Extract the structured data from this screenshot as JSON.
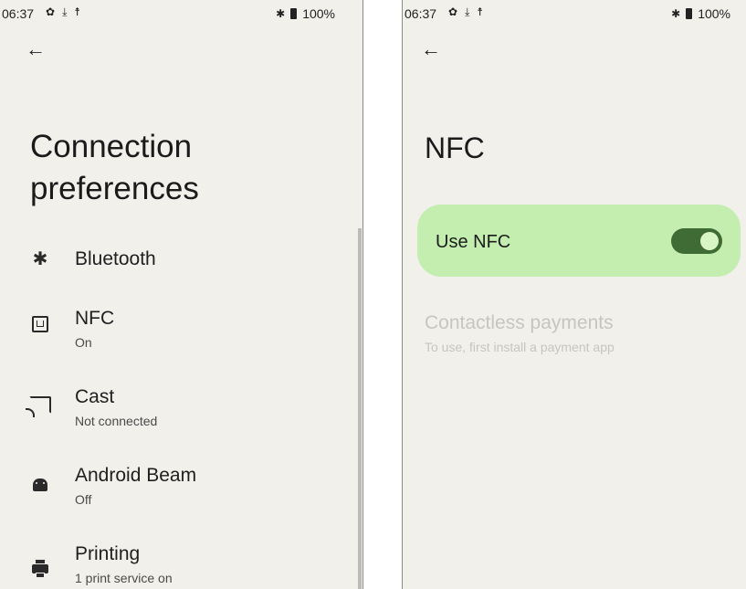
{
  "status_bar": {
    "time": "06:37",
    "battery": "100%",
    "icons": [
      "settings-icon",
      "download-icon",
      "accessibility-icon",
      "bluetooth-icon",
      "battery-icon"
    ]
  },
  "left_screen": {
    "title": "Connection preferences",
    "items": [
      {
        "label": "Bluetooth",
        "summary": "",
        "icon": "bluetooth-icon"
      },
      {
        "label": "NFC",
        "summary": "On",
        "icon": "nfc-icon"
      },
      {
        "label": "Cast",
        "summary": "Not connected",
        "icon": "cast-icon"
      },
      {
        "label": "Android Beam",
        "summary": "Off",
        "icon": "android-icon"
      },
      {
        "label": "Printing",
        "summary": "1 print service on",
        "icon": "printer-icon"
      }
    ]
  },
  "right_screen": {
    "title": "NFC",
    "use_nfc": {
      "label": "Use NFC",
      "enabled": true
    },
    "contactless": {
      "title": "Contactless payments",
      "summary": "To use, first install a payment app"
    }
  },
  "colors": {
    "background": "#f1f0eb",
    "card": "#c3eeb0",
    "toggle_track": "#3f6b34",
    "toggle_thumb": "#d8f6c5",
    "disabled_text": "#c6c5bf"
  }
}
